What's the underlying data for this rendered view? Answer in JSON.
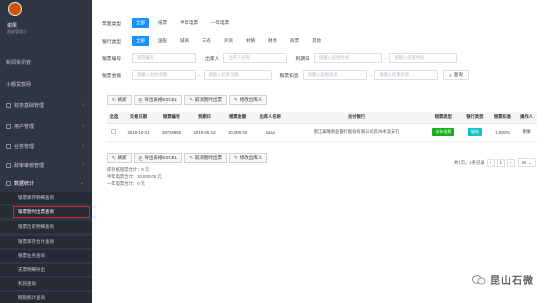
{
  "sidebar": {
    "user_name": "谢果",
    "user_role": "超级管理员 ·",
    "items": [
      {
        "label": "新闻资讯管"
      },
      {
        "label": "小额贷款网"
      },
      {
        "label": "财务基础管理"
      },
      {
        "label": "用户管理"
      },
      {
        "label": "业务管理"
      },
      {
        "label": "财审审核管理"
      },
      {
        "label": "数据统计"
      }
    ],
    "subs": [
      {
        "label": "银票库存明细查询"
      },
      {
        "label": "银票暂时出票查询"
      },
      {
        "label": "银票历史明细查询"
      },
      {
        "label": "银票库存合计查询"
      },
      {
        "label": "银票业务查询"
      },
      {
        "label": "支票明细导出"
      },
      {
        "label": "利润查询"
      },
      {
        "label": "网银统计查询"
      }
    ]
  },
  "filters": {
    "type_label": "票面类型",
    "type_chips": [
      "全部",
      "纸票",
      "半年电票",
      "一年电票"
    ],
    "bank_label": "银行类型",
    "bank_chips": [
      "全部",
      "国股",
      "城商",
      "三农",
      "外资",
      "村镇",
      "财务",
      "商票",
      "其他"
    ],
    "bill_no_label": "银票编号",
    "bill_no_placeholder": "银票编号",
    "payee_label": "出库人",
    "payee_placeholder": "出库人名称",
    "due_label": "到期日",
    "due_start_placeholder": "请输入起始时间",
    "due_end_placeholder": "请输入结束时间",
    "amount_label": "银票金额",
    "amount_start_placeholder": "请输入起始金额",
    "amount_end_placeholder": "请输入结束金额",
    "discount_label": "银票扣息",
    "discount_start_placeholder": "请输入起始扣息",
    "discount_end_placeholder": "请输入结束扣息",
    "range_sep": "-",
    "search_label": "查询"
  },
  "toolbar": {
    "refresh": "刷新",
    "export": "导出表格EXCEL",
    "cancel": "取消暂时出票",
    "edit": "修改出库人"
  },
  "table": {
    "headers": [
      "全选",
      "交易日期",
      "银票编号",
      "到期日",
      "银票金额",
      "出库人名称",
      "兑付银行",
      "银票类型",
      "银行类型",
      "银票扣息",
      "操作人"
    ],
    "rows": [
      {
        "date": "2018-12-21",
        "no": "28726855",
        "due": "2019-05-13",
        "amount": "10,000.00",
        "payee": "sasa",
        "bank": "浙江泰隆商业银行股份有限公司苏州木渎支行",
        "bill_type": "半年电票",
        "bank_type": "城商",
        "discount": "1.000%",
        "operator": "谢果"
      }
    ]
  },
  "summary": {
    "line1": "库存纸银票合计：0 元",
    "line2": "半年电票合计：10,000.00 元",
    "line3": "一年电票合计：0 元"
  },
  "pager": {
    "info": "共1页，1条记录",
    "prev": "‹",
    "page": "1",
    "next": "›",
    "size": "20"
  },
  "watermark": {
    "text": "昆山石微"
  },
  "colors": {
    "primary": "#1890ff",
    "sidebar": "#2f3542",
    "badge_half": "#1aad19",
    "badge_bank": "#13c2c2",
    "highlight": "#d9251d"
  }
}
